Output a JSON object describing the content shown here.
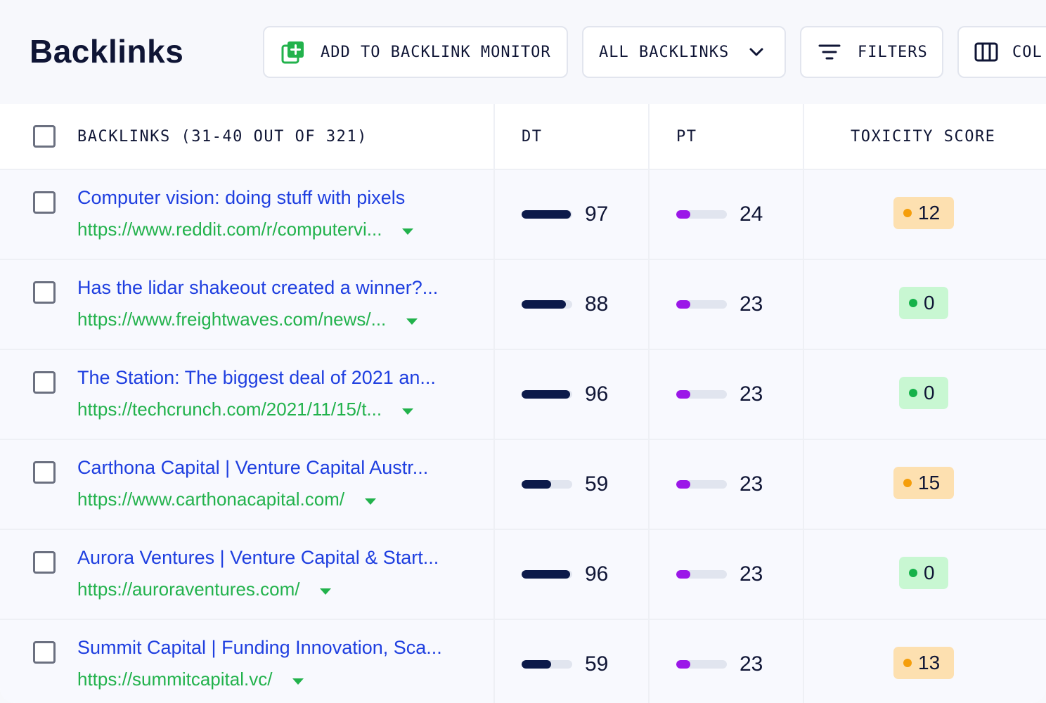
{
  "header": {
    "title": "Backlinks",
    "add_button": "ADD TO BACKLINK MONITOR",
    "view_select": "ALL BACKLINKS",
    "filters_button": "FILTERS",
    "columns_button": "COL"
  },
  "table": {
    "col_backlinks": "BACKLINKS (31-40 OUT OF 321)",
    "col_dt": "DT",
    "col_pt": "PT",
    "col_toxicity": "TOXICITY SCORE",
    "rows": [
      {
        "title": "Computer vision: doing stuff with pixels",
        "url": "https://www.reddit.com/r/computervi...",
        "dt": "97",
        "pt": "24",
        "toxicity": "12",
        "toxicity_level": "warn"
      },
      {
        "title": "Has the lidar shakeout created a winner?...",
        "url": "https://www.freightwaves.com/news/...",
        "dt": "88",
        "pt": "23",
        "toxicity": "0",
        "toxicity_level": "ok"
      },
      {
        "title": "The Station: The biggest deal of 2021 an...",
        "url": "https://techcrunch.com/2021/11/15/t...",
        "dt": "96",
        "pt": "23",
        "toxicity": "0",
        "toxicity_level": "ok"
      },
      {
        "title": "Carthona Capital | Venture Capital Austr...",
        "url": "https://www.carthonacapital.com/",
        "dt": "59",
        "pt": "23",
        "toxicity": "15",
        "toxicity_level": "warn"
      },
      {
        "title": "Aurora Ventures | Venture Capital & Start...",
        "url": "https://auroraventures.com/",
        "dt": "96",
        "pt": "23",
        "toxicity": "0",
        "toxicity_level": "ok"
      },
      {
        "title": "Summit Capital | Funding Innovation, Sca...",
        "url": "https://summitcapital.vc/",
        "dt": "59",
        "pt": "23",
        "toxicity": "13",
        "toxicity_level": "warn"
      }
    ]
  },
  "colors": {
    "link_title": "#1f3fe0",
    "link_url": "#22b24c",
    "dt_bar": "#0c1a4a",
    "pt_bar": "#9b17e8",
    "bar_track": "#e1e5ef"
  },
  "icons": {
    "add": "add-square-icon",
    "dropdown": "chevron-down-icon",
    "filters": "filter-lines-icon",
    "columns": "columns-icon",
    "url_caret": "caret-down-icon"
  }
}
